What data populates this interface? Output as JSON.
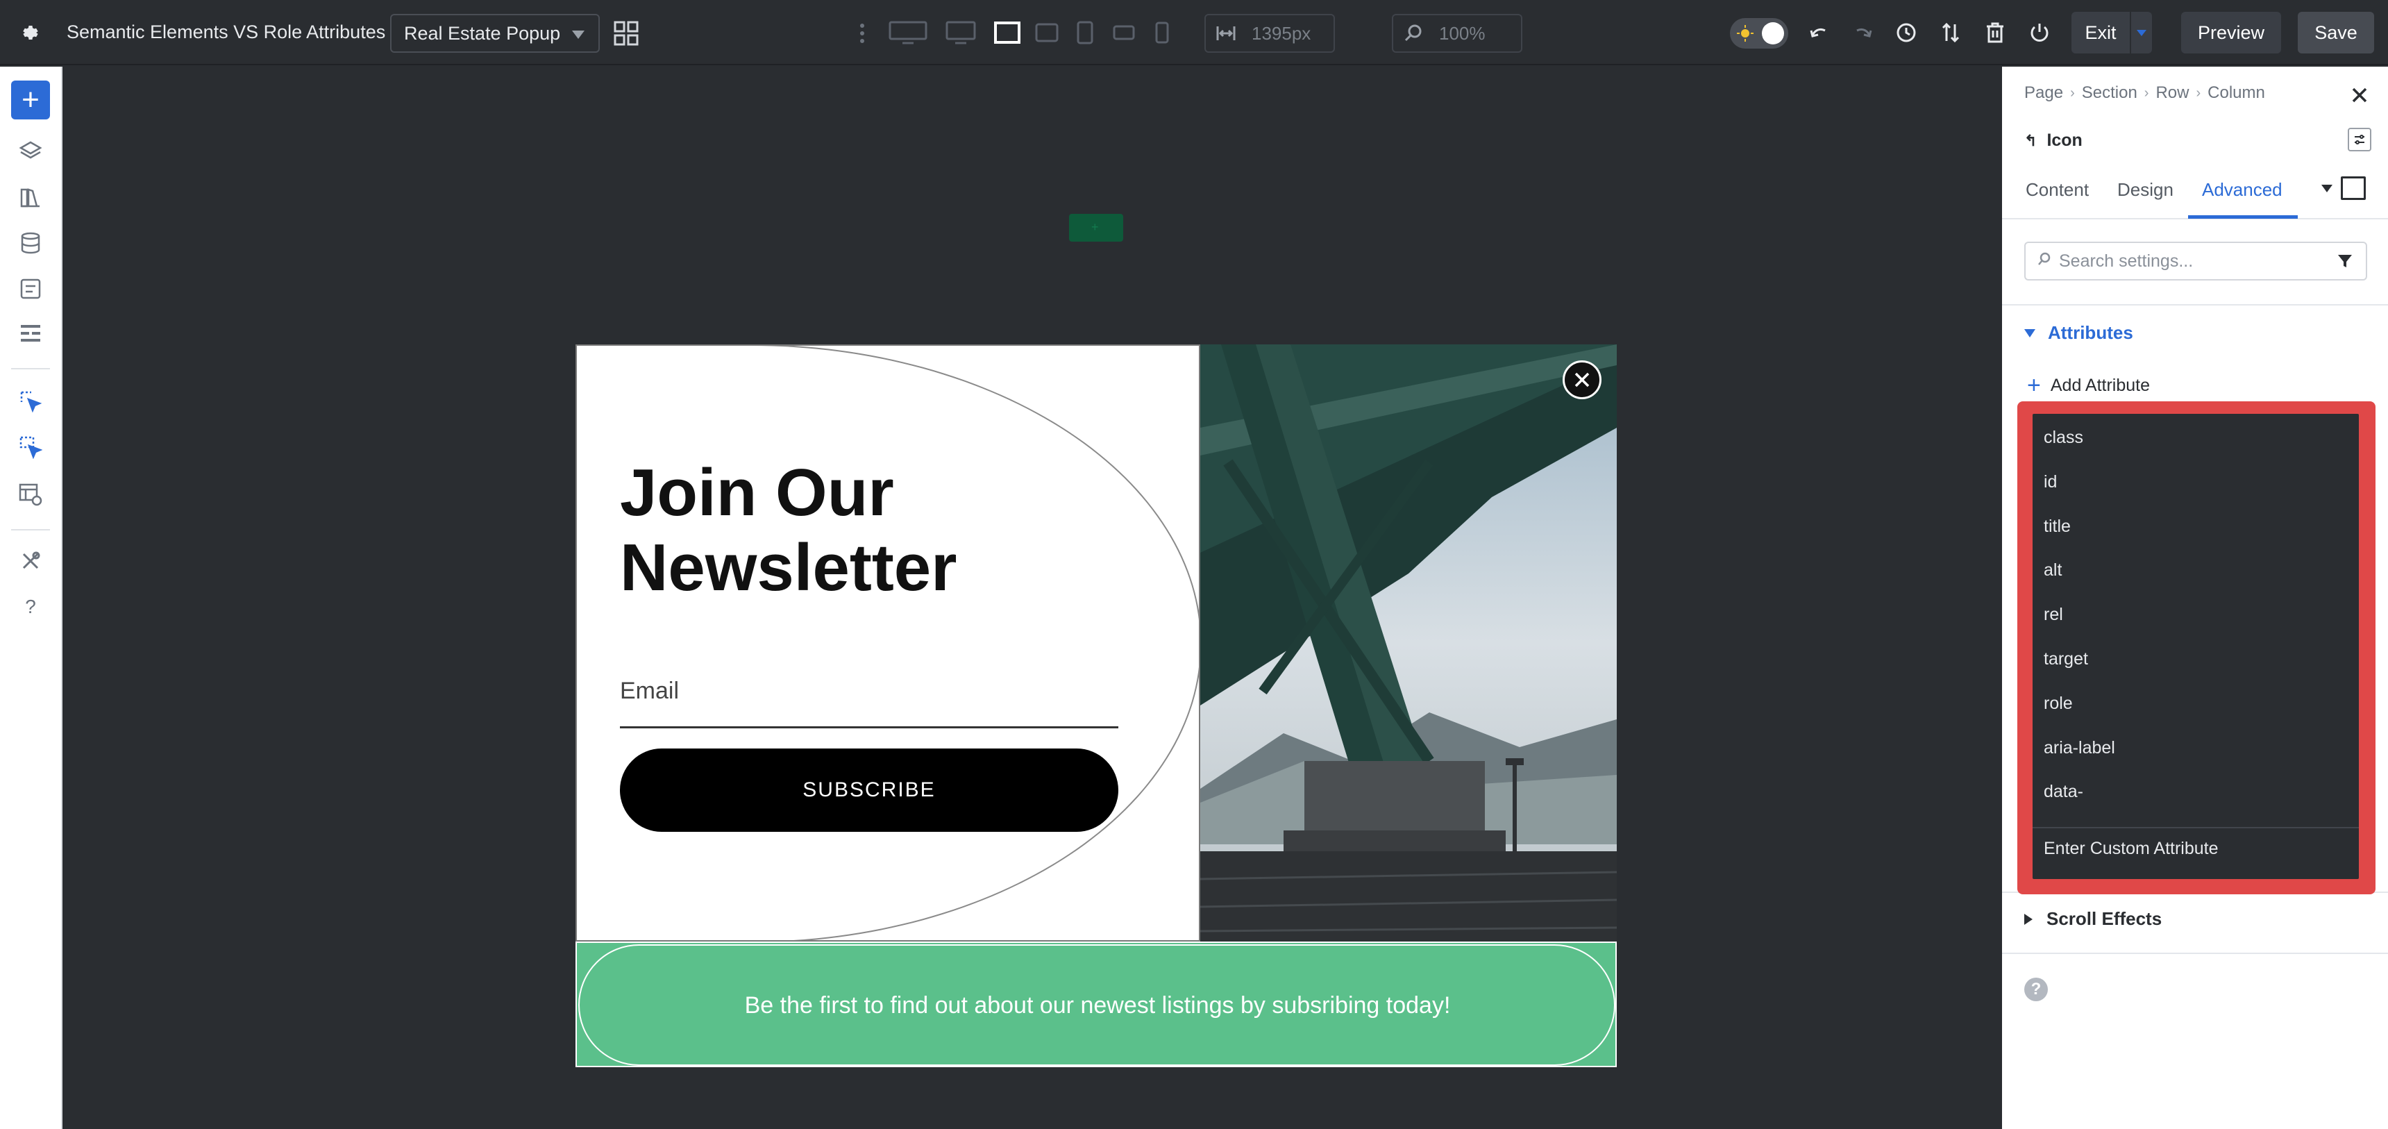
{
  "topbar": {
    "page_title": "Semantic Elements VS Role Attributes",
    "layout_select": "Real Estate Popup",
    "width_value": "1395px",
    "zoom_value": "100%",
    "exit_label": "Exit",
    "preview_label": "Preview",
    "save_label": "Save",
    "device_icons": [
      "desktop-wide-icon",
      "desktop-icon",
      "laptop-icon",
      "tablet-landscape-icon",
      "tablet-icon",
      "phone-landscape-icon",
      "phone-icon"
    ],
    "active_device": "laptop-icon",
    "action_icons": [
      "undo-icon",
      "redo-icon",
      "history-icon",
      "sort-icon",
      "trash-icon",
      "power-icon"
    ]
  },
  "sidebar": {
    "icons": [
      "add-icon",
      "layers-icon",
      "library-icon",
      "database-icon",
      "forms-icon",
      "templates-icon",
      "select-tool-icon",
      "multi-select-icon",
      "settings-table-icon",
      "tools-icon",
      "help-icon"
    ]
  },
  "popup": {
    "heading": "Join Our Newsletter",
    "email_placeholder": "Email",
    "subscribe_label": "SUBSCRIBE",
    "banner_text": "Be the first to find out about our newest listings by subsribing today!"
  },
  "panel": {
    "breadcrumb": [
      "Page",
      "Section",
      "Row",
      "Column"
    ],
    "module_title": "Icon",
    "tabs": [
      "Content",
      "Design",
      "Advanced"
    ],
    "active_tab": "Advanced",
    "search_placeholder": "Search settings...",
    "attributes_header": "Attributes",
    "add_attribute_label": "Add Attribute",
    "dropdown_items": [
      "class",
      "id",
      "title",
      "alt",
      "rel",
      "target",
      "role",
      "aria-label",
      "data-"
    ],
    "custom_attribute_label": "Enter Custom Attribute",
    "scroll_effects_label": "Scroll Effects"
  },
  "colors": {
    "accent": "#2c6bd6",
    "highlight": "#e04848",
    "banner": "#5bc08b",
    "dark_ui": "#2a2d31"
  }
}
